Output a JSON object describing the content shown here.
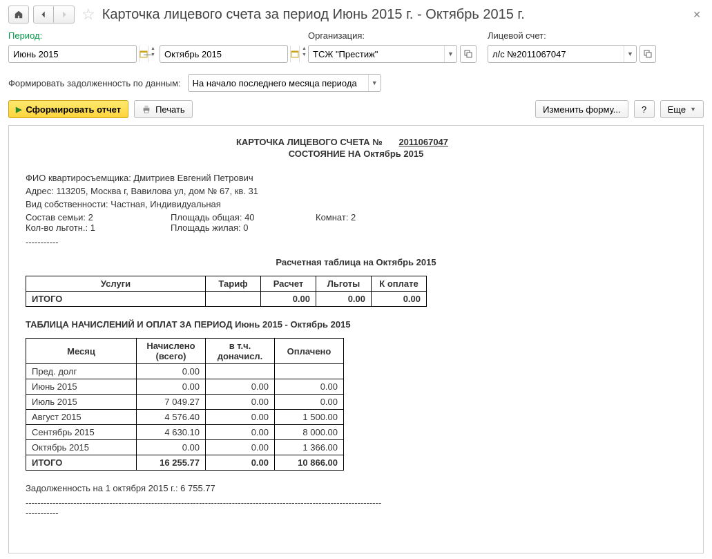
{
  "title": "Карточка лицевого счета за период Июнь 2015 г. - Октябрь 2015 г.",
  "labels": {
    "period": "Период:",
    "org": "Организация:",
    "account": "Лицевой счет:",
    "debt_by": "Формировать задолженность по данным:"
  },
  "period": {
    "from": "Июнь 2015",
    "to": "Октябрь 2015",
    "dash": "—"
  },
  "org": "ТСЖ \"Престиж\"",
  "account": "л/с №2011067047",
  "debt_option": "На начало последнего месяца периода",
  "buttons": {
    "generate": "Сформировать отчет",
    "print": "Печать",
    "edit_form": "Изменить форму...",
    "more": "Еще",
    "help": "?"
  },
  "report": {
    "title_prefix": "КАРТОЧКА ЛИЦЕВОГО СЧЕТА №",
    "title_number": "2011067047",
    "state": "СОСТОЯНИЕ НА Октябрь 2015",
    "fio": "ФИО квартиросъемщика: Дмитриев Евгений Петрович",
    "addr": "Адрес: 113205, Москва г, Вавилова ул, дом № 67, кв. 31",
    "own": "Вид собственности: Частная, Индивидуальная",
    "family": "Состав семьи: 2",
    "area_total": "Площадь общая: 40",
    "rooms": "Комнат: 2",
    "benefits": "Кол-во льготн.: 1",
    "area_live": "Площадь жилая: 0",
    "dashes": "-----------",
    "calc_title": "Расчетная таблица на Октябрь 2015",
    "calc_headers": [
      "Услуги",
      "Тариф",
      "Расчет",
      "Льготы",
      "К оплате"
    ],
    "calc_total_label": "ИТОГО",
    "calc_total": [
      "",
      "0.00",
      "0.00",
      "0.00"
    ],
    "charges_title": "ТАБЛИЦА НАЧИСЛЕНИЙ И ОПЛАТ ЗА ПЕРИОД Июнь 2015 - Октябрь 2015",
    "charges_headers": [
      "Месяц",
      "Начислено (всего)",
      "в т.ч. доначисл.",
      "Оплачено"
    ],
    "charges_rows": [
      {
        "m": "Пред. долг",
        "a": "0.00",
        "b": "",
        "c": ""
      },
      {
        "m": "Июнь 2015",
        "a": "0.00",
        "b": "0.00",
        "c": "0.00"
      },
      {
        "m": "Июль 2015",
        "a": "7 049.27",
        "b": "0.00",
        "c": "0.00"
      },
      {
        "m": "Август 2015",
        "a": "4 576.40",
        "b": "0.00",
        "c": "1 500.00"
      },
      {
        "m": "Сентябрь 2015",
        "a": "4 630.10",
        "b": "0.00",
        "c": "8 000.00"
      },
      {
        "m": "Октябрь 2015",
        "a": "0.00",
        "b": "0.00",
        "c": "1 366.00"
      }
    ],
    "charges_total": {
      "m": "ИТОГО",
      "a": "16 255.77",
      "b": "0.00",
      "c": "10 866.00"
    },
    "debt": "Задолженность на 1 октября 2015 г.: 6 755.77",
    "long_dashes": "-----------------------------------------------------------------------------------------------------------------------"
  }
}
